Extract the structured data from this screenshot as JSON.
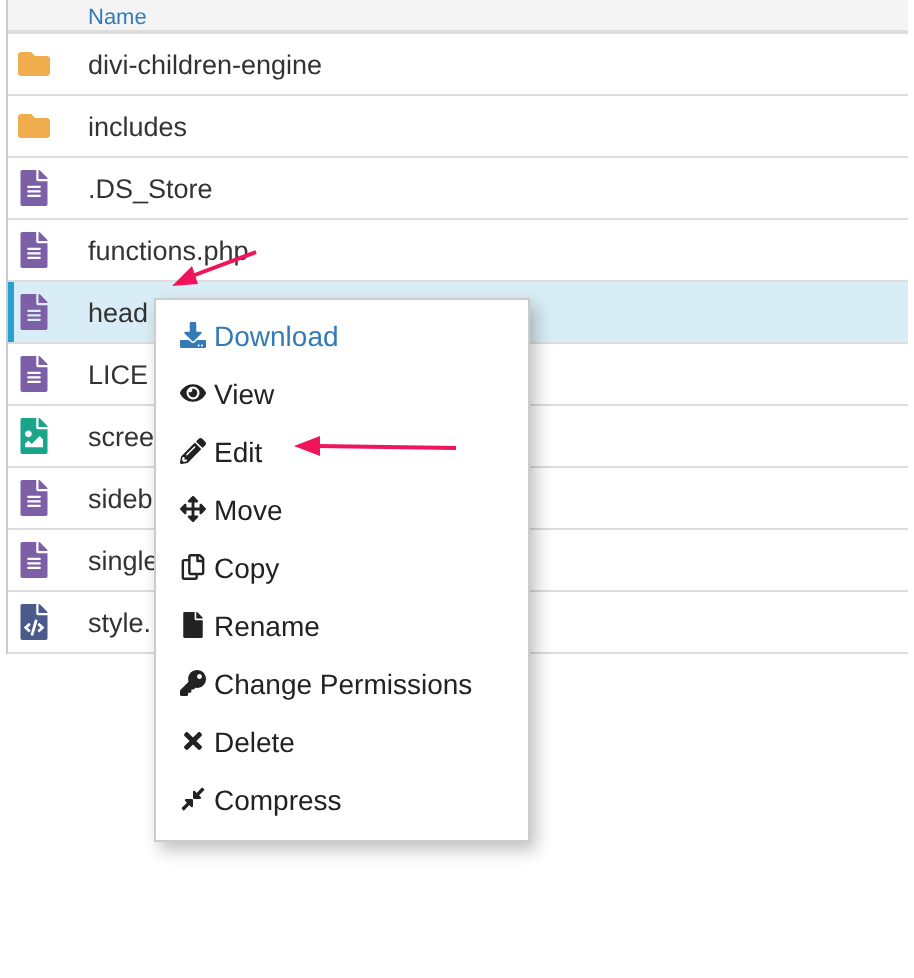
{
  "table": {
    "columns": [
      "Name"
    ],
    "rows": [
      {
        "name": "divi-children-engine",
        "kind": "folder",
        "selected": false
      },
      {
        "name": "includes",
        "kind": "folder",
        "selected": false
      },
      {
        "name": ".DS_Store",
        "kind": "file",
        "selected": false
      },
      {
        "name": "functions.php",
        "kind": "file",
        "selected": false
      },
      {
        "name": "head",
        "kind": "file",
        "selected": true
      },
      {
        "name": "LICE",
        "kind": "file",
        "selected": false
      },
      {
        "name": "scree",
        "kind": "image",
        "selected": false
      },
      {
        "name": "sideb",
        "kind": "file",
        "selected": false
      },
      {
        "name": "single",
        "kind": "file",
        "selected": false
      },
      {
        "name": "style.",
        "kind": "code",
        "selected": false
      }
    ]
  },
  "context_menu": {
    "items": [
      {
        "label": "Download",
        "selected": true
      },
      {
        "label": "View",
        "selected": false
      },
      {
        "label": "Edit",
        "selected": false
      },
      {
        "label": "Move",
        "selected": false
      },
      {
        "label": "Copy",
        "selected": false
      },
      {
        "label": "Rename",
        "selected": false
      },
      {
        "label": "Change Permissions",
        "selected": false
      },
      {
        "label": "Delete",
        "selected": false
      },
      {
        "label": "Compress",
        "selected": false
      }
    ]
  }
}
